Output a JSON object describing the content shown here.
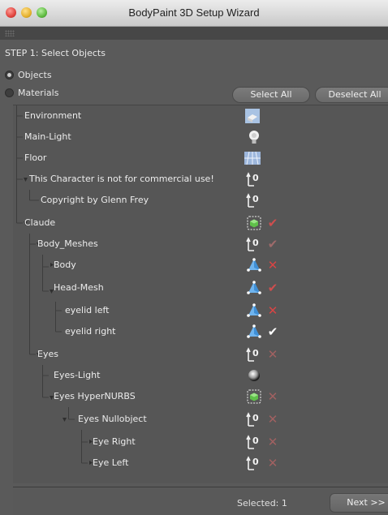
{
  "window": {
    "title": "BodyPaint 3D Setup Wizard"
  },
  "step": {
    "title": "STEP 1: Select Objects"
  },
  "mode": {
    "options": [
      {
        "label": "Objects",
        "selected": true
      },
      {
        "label": "Materials",
        "selected": false
      }
    ]
  },
  "toolbar": {
    "select_all_label": "Select All",
    "deselect_all_label": "Deselect All"
  },
  "tree": {
    "rows": [
      {
        "label": "Environment",
        "icon": "environment-icon",
        "state": "none"
      },
      {
        "label": "Main-Light",
        "icon": "light-bulb-icon",
        "state": "none"
      },
      {
        "label": "Floor",
        "icon": "floor-grid-icon",
        "state": "none"
      },
      {
        "label": "This Character is not for commercial use!",
        "icon": "null-object-icon",
        "state": "none"
      },
      {
        "label": "Copyright by Glenn Frey",
        "icon": "null-object-icon",
        "state": "none"
      },
      {
        "label": "Claude",
        "icon": "hypernurbs-icon",
        "state": "check-red"
      },
      {
        "label": "Body_Meshes",
        "icon": "null-object-icon",
        "state": "check-dim"
      },
      {
        "label": "Body",
        "icon": "polygon-object-icon",
        "state": "cross"
      },
      {
        "label": "Head-Mesh",
        "icon": "polygon-object-icon",
        "state": "check-red"
      },
      {
        "label": "eyelid left",
        "icon": "polygon-object-icon",
        "state": "cross"
      },
      {
        "label": "eyelid right",
        "icon": "polygon-object-icon",
        "state": "check-white"
      },
      {
        "label": "Eyes",
        "icon": "null-object-icon",
        "state": "cross-dim"
      },
      {
        "label": "Eyes-Light",
        "icon": "light-sphere-icon",
        "state": "none"
      },
      {
        "label": "Eyes HyperNURBS",
        "icon": "hypernurbs-icon",
        "state": "cross-dim"
      },
      {
        "label": "Eyes Nullobject",
        "icon": "null-object-icon",
        "state": "cross-dim"
      },
      {
        "label": "Eye Right",
        "icon": "null-object-icon",
        "state": "cross-dim"
      },
      {
        "label": "Eye Left",
        "icon": "null-object-icon",
        "state": "cross-dim"
      }
    ]
  },
  "footer": {
    "selected_text": "Selected: 1",
    "next_label": "Next >>"
  }
}
